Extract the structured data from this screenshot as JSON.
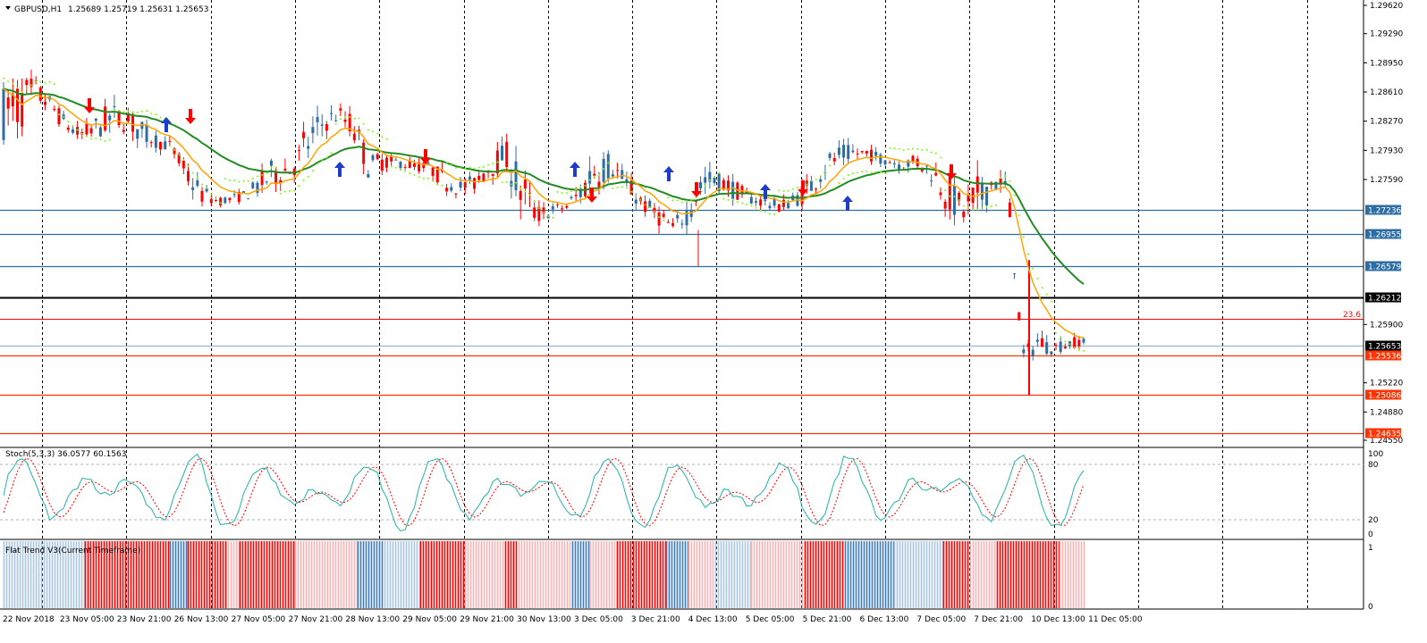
{
  "header": {
    "symbol_label": "GBPUSD,H1",
    "ohlc_label": "1.25689 1.25719 1.25631 1.25653"
  },
  "price_axis": {
    "ticks": [
      "1.29620",
      "1.29290",
      "1.28950",
      "1.28610",
      "1.28270",
      "1.27930",
      "1.27590",
      "1.25900",
      "1.25220",
      "1.24880",
      "1.24550"
    ]
  },
  "level_lines": [
    {
      "value": "1.27236",
      "color": "#2e6ca4",
      "badge_bg": "#2e6ca4",
      "badge_fg": "#ffffff"
    },
    {
      "value": "1.26955",
      "color": "#2e6ca4",
      "badge_bg": "#2e6ca4",
      "badge_fg": "#ffffff"
    },
    {
      "value": "1.26579",
      "color": "#2e6ca4",
      "badge_bg": "#2e6ca4",
      "badge_fg": "#ffffff"
    },
    {
      "value": "1.26212",
      "color": "#000000",
      "badge_bg": "#000000",
      "badge_fg": "#ffffff"
    },
    {
      "value": "1.25653",
      "color": "#9fb4c8",
      "badge_bg": "#000000",
      "badge_fg": "#ffffff"
    },
    {
      "value": "1.25536",
      "color": "#ff3300",
      "badge_bg": "#ff3300",
      "badge_fg": "#ffffff"
    },
    {
      "value": "1.25086",
      "color": "#ff3300",
      "badge_bg": "#ff3300",
      "badge_fg": "#ffffff"
    },
    {
      "value": "1.24635",
      "color": "#ff3300",
      "badge_bg": "#ff3300",
      "badge_fg": "#ffffff"
    }
  ],
  "fibo": {
    "label": "23.6",
    "color": "#ff0000"
  },
  "stoch": {
    "label": "Stoch(5,3,3) 36.0577 60.1563",
    "ticks": [
      "100",
      "80",
      "20",
      "0"
    ]
  },
  "flat_trend": {
    "label": "Flat Trend V3(Current Timeframe)",
    "ticks": [
      "1",
      "0"
    ]
  },
  "time_axis": {
    "labels": [
      "22 Nov 2018",
      "23 Nov 05:00",
      "23 Nov 21:00",
      "26 Nov 13:00",
      "27 Nov 05:00",
      "27 Nov 21:00",
      "28 Nov 13:00",
      "29 Nov 05:00",
      "29 Nov 21:00",
      "30 Nov 13:00",
      "3 Dec 05:00",
      "3 Dec 21:00",
      "4 Dec 13:00",
      "5 Dec 05:00",
      "5 Dec 21:00",
      "6 Dec 13:00",
      "7 Dec 05:00",
      "7 Dec 21:00",
      "10 Dec 13:00",
      "11 Dec 05:00"
    ]
  },
  "colors": {
    "bull": "#2e6ca4",
    "bear": "#ff0000",
    "ma_fast": "#ffa500",
    "ma_slow": "#228b22",
    "psar": "#7cfc00",
    "stoch_main": "#20b2aa",
    "stoch_signal": "#ff0000",
    "grid": "#000000"
  },
  "chart_data": {
    "type": "candlestick",
    "anchors": [
      [
        1.287,
        1.2805
      ],
      [
        1.2878,
        1.281
      ],
      [
        1.288,
        1.2845
      ],
      [
        1.286,
        1.2835
      ],
      [
        1.2835,
        1.2815
      ],
      [
        1.282,
        1.28
      ],
      [
        1.2832,
        1.2805
      ],
      [
        1.285,
        1.281
      ],
      [
        1.2845,
        1.2815
      ],
      [
        1.283,
        1.28
      ],
      [
        1.2815,
        1.2795
      ],
      [
        1.2805,
        1.279
      ],
      [
        1.278,
        1.275
      ],
      [
        1.2755,
        1.273
      ],
      [
        1.274,
        1.2728
      ],
      [
        1.2742,
        1.273
      ],
      [
        1.2748,
        1.2735
      ],
      [
        1.277,
        1.274
      ],
      [
        1.279,
        1.275
      ],
      [
        1.278,
        1.276
      ],
      [
        1.283,
        1.2775
      ],
      [
        1.284,
        1.281
      ],
      [
        1.2845,
        1.2825
      ],
      [
        1.2838,
        1.28
      ],
      [
        1.279,
        1.276
      ],
      [
        1.279,
        1.277
      ],
      [
        1.2785,
        1.2772
      ],
      [
        1.2782,
        1.2768
      ],
      [
        1.278,
        1.2765
      ],
      [
        1.277,
        1.2745
      ],
      [
        1.276,
        1.274
      ],
      [
        1.2765,
        1.2745
      ],
      [
        1.279,
        1.276
      ],
      [
        1.2805,
        1.277
      ],
      [
        1.278,
        1.2715
      ],
      [
        1.273,
        1.2705
      ],
      [
        1.273,
        1.2715
      ],
      [
        1.2735,
        1.272
      ],
      [
        1.276,
        1.273
      ],
      [
        1.281,
        1.2745
      ],
      [
        1.279,
        1.276
      ],
      [
        1.2765,
        1.274
      ],
      [
        1.274,
        1.272
      ],
      [
        1.273,
        1.2705
      ],
      [
        1.271,
        1.2695
      ],
      [
        1.274,
        1.2705
      ],
      [
        1.2775,
        1.274
      ],
      [
        1.277,
        1.2745
      ],
      [
        1.276,
        1.2735
      ],
      [
        1.2745,
        1.273
      ],
      [
        1.274,
        1.2725
      ],
      [
        1.2735,
        1.272
      ],
      [
        1.2745,
        1.2725
      ],
      [
        1.2765,
        1.2735
      ],
      [
        1.279,
        1.276
      ],
      [
        1.28,
        1.2775
      ],
      [
        1.28,
        1.278
      ],
      [
        1.2795,
        1.278
      ],
      [
        1.279,
        1.2775
      ],
      [
        1.2785,
        1.2768
      ],
      [
        1.279,
        1.277
      ],
      [
        1.278,
        1.2755
      ],
      [
        1.277,
        1.272
      ],
      [
        1.274,
        1.2705
      ],
      [
        1.2765,
        1.27
      ],
      [
        1.277,
        1.2745
      ],
      [
        1.2765,
        1.273
      ],
      [
        1.256,
        1.2545
      ],
      [
        1.2585,
        1.2555
      ],
      [
        1.257,
        1.2555
      ],
      [
        1.2575,
        1.256
      ],
      [
        1.2578,
        1.2566
      ]
    ],
    "current_price": 1.25653
  }
}
